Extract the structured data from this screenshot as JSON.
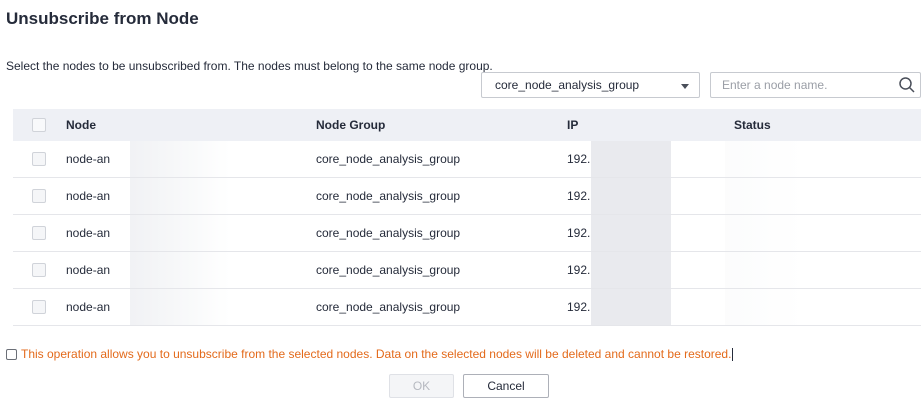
{
  "dialog": {
    "title": "Unsubscribe from Node",
    "description": "Select the nodes to be unsubscribed from. The nodes must belong to the same node group."
  },
  "filters": {
    "node_group_selected": "core_node_analysis_group",
    "search_placeholder": "Enter a node name.",
    "search_value": ""
  },
  "table": {
    "columns": [
      "Node",
      "Node Group",
      "IP",
      "Status"
    ],
    "rows": [
      {
        "node": "node-an",
        "group": "core_node_analysis_group",
        "ip": "192."
      },
      {
        "node": "node-an",
        "group": "core_node_analysis_group",
        "ip": "192."
      },
      {
        "node": "node-an",
        "group": "core_node_analysis_group",
        "ip": "192."
      },
      {
        "node": "node-an",
        "group": "core_node_analysis_group",
        "ip": "192."
      },
      {
        "node": "node-an",
        "group": "core_node_analysis_group",
        "ip": "192."
      }
    ]
  },
  "warning": {
    "text": "This operation allows you to unsubscribe from the selected nodes. Data on the selected nodes will be deleted and cannot be restored."
  },
  "buttons": {
    "ok": "OK",
    "cancel": "Cancel"
  },
  "colors": {
    "warning": "#e36a1b",
    "header_bg": "#eef0f5",
    "text": "#252b3a"
  },
  "icons": {
    "search": "search-icon",
    "dropdown": "chevron-down-icon"
  }
}
